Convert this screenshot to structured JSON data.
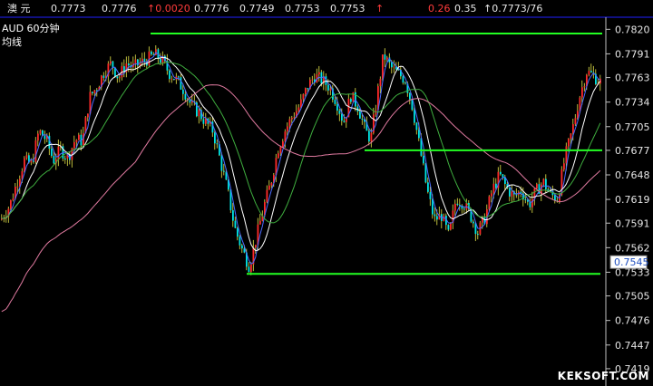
{
  "quote_bar": {
    "instrument": "澳 元",
    "fields": [
      {
        "value": "0.7773",
        "color": "#e6e6e6"
      },
      {
        "value": "0.7776",
        "color": "#e6e6e6"
      },
      {
        "value": "↑0.0020",
        "color": "#ff3b3b"
      },
      {
        "value": "0.7776",
        "color": "#e6e6e6"
      },
      {
        "value": "0.7749",
        "color": "#e6e6e6"
      },
      {
        "value": "0.7753",
        "color": "#e6e6e6"
      },
      {
        "value": "0.7753",
        "color": "#e6e6e6"
      },
      {
        "value": "↑",
        "color": "#ff3b3b"
      },
      {
        "value": "0.26",
        "color": "#ff3b3b"
      },
      {
        "value": "0.35",
        "color": "#e6e6e6"
      },
      {
        "value": "↑0.7773/76",
        "color": "#e6e6e6"
      }
    ]
  },
  "chart_label": {
    "line1": "AUD   60分钟",
    "line2": "均线"
  },
  "watermark": "KEKSOFT.COM",
  "chart_data": {
    "type": "candlestick",
    "interval": "60分钟",
    "y_axis": {
      "ticks": [
        "0.7820",
        "0.7791",
        "0.7763",
        "0.7734",
        "0.7705",
        "0.7677",
        "0.7648",
        "0.7619",
        "0.7591",
        "0.7562",
        "0.7533",
        "0.7505",
        "0.7476",
        "0.7447",
        "0.7419"
      ],
      "range": [
        0.7405,
        0.783
      ],
      "current_price_label": "0.7545"
    },
    "price_path": [
      [
        0,
        0.7595
      ],
      [
        10,
        0.7612
      ],
      [
        18,
        0.764
      ],
      [
        26,
        0.7665
      ],
      [
        34,
        0.766
      ],
      [
        42,
        0.77
      ],
      [
        50,
        0.769
      ],
      [
        58,
        0.7665
      ],
      [
        66,
        0.7678
      ],
      [
        74,
        0.7668
      ],
      [
        82,
        0.769
      ],
      [
        90,
        0.7688
      ],
      [
        98,
        0.774
      ],
      [
        106,
        0.7752
      ],
      [
        114,
        0.777
      ],
      [
        122,
        0.778
      ],
      [
        130,
        0.7762
      ],
      [
        138,
        0.778
      ],
      [
        146,
        0.7775
      ],
      [
        154,
        0.778
      ],
      [
        162,
        0.7785
      ],
      [
        170,
        0.779
      ],
      [
        178,
        0.7783
      ],
      [
        186,
        0.7768
      ],
      [
        194,
        0.776
      ],
      [
        202,
        0.7748
      ],
      [
        210,
        0.773
      ],
      [
        218,
        0.7722
      ],
      [
        226,
        0.771
      ],
      [
        234,
        0.77
      ],
      [
        242,
        0.7665
      ],
      [
        250,
        0.763
      ],
      [
        258,
        0.7585
      ],
      [
        266,
        0.756
      ],
      [
        274,
        0.754
      ],
      [
        282,
        0.7575
      ],
      [
        290,
        0.761
      ],
      [
        298,
        0.764
      ],
      [
        306,
        0.768
      ],
      [
        314,
        0.7702
      ],
      [
        322,
        0.7718
      ],
      [
        330,
        0.773
      ],
      [
        338,
        0.7752
      ],
      [
        346,
        0.7765
      ],
      [
        354,
        0.776
      ],
      [
        362,
        0.7752
      ],
      [
        370,
        0.7735
      ],
      [
        378,
        0.771
      ],
      [
        386,
        0.7742
      ],
      [
        394,
        0.7728
      ],
      [
        402,
        0.77
      ],
      [
        408,
        0.769
      ],
      [
        416,
        0.7748
      ],
      [
        422,
        0.779
      ],
      [
        430,
        0.7775
      ],
      [
        438,
        0.7768
      ],
      [
        446,
        0.776
      ],
      [
        454,
        0.7728
      ],
      [
        462,
        0.768
      ],
      [
        470,
        0.763
      ],
      [
        478,
        0.7595
      ],
      [
        486,
        0.76
      ],
      [
        494,
        0.7575
      ],
      [
        502,
        0.762
      ],
      [
        510,
        0.7615
      ],
      [
        518,
        0.76
      ],
      [
        526,
        0.758
      ],
      [
        534,
        0.7598
      ],
      [
        542,
        0.763
      ],
      [
        550,
        0.7648
      ],
      [
        558,
        0.7632
      ],
      [
        566,
        0.7622
      ],
      [
        574,
        0.763
      ],
      [
        582,
        0.7612
      ],
      [
        590,
        0.7628
      ],
      [
        598,
        0.764
      ],
      [
        606,
        0.7625
      ],
      [
        614,
        0.762
      ],
      [
        622,
        0.7668
      ],
      [
        630,
        0.77
      ],
      [
        638,
        0.774
      ],
      [
        646,
        0.777
      ],
      [
        654,
        0.7765
      ],
      [
        660,
        0.7758
      ]
    ],
    "moving_averages": [
      {
        "color": "#4b6bff",
        "period_hint": "short"
      },
      {
        "color": "#ffffff",
        "period_hint": "medium"
      },
      {
        "color": "#3fae3f",
        "period_hint": "long"
      },
      {
        "color": "#e07aa0",
        "period_hint": "longest"
      }
    ],
    "horizontal_levels": [
      {
        "price": 0.7815,
        "x_from": 0.7815,
        "color": "#22ff22"
      },
      {
        "price": 0.7677,
        "color": "#22ff22"
      },
      {
        "price": 0.7531,
        "color": "#22ff22"
      }
    ],
    "colors": {
      "up": "#ff2a2a",
      "down": "#00e5e5",
      "shadow": "#e8e84a",
      "axis": "#c0c0c0",
      "grid_border": "#2020ff"
    }
  }
}
